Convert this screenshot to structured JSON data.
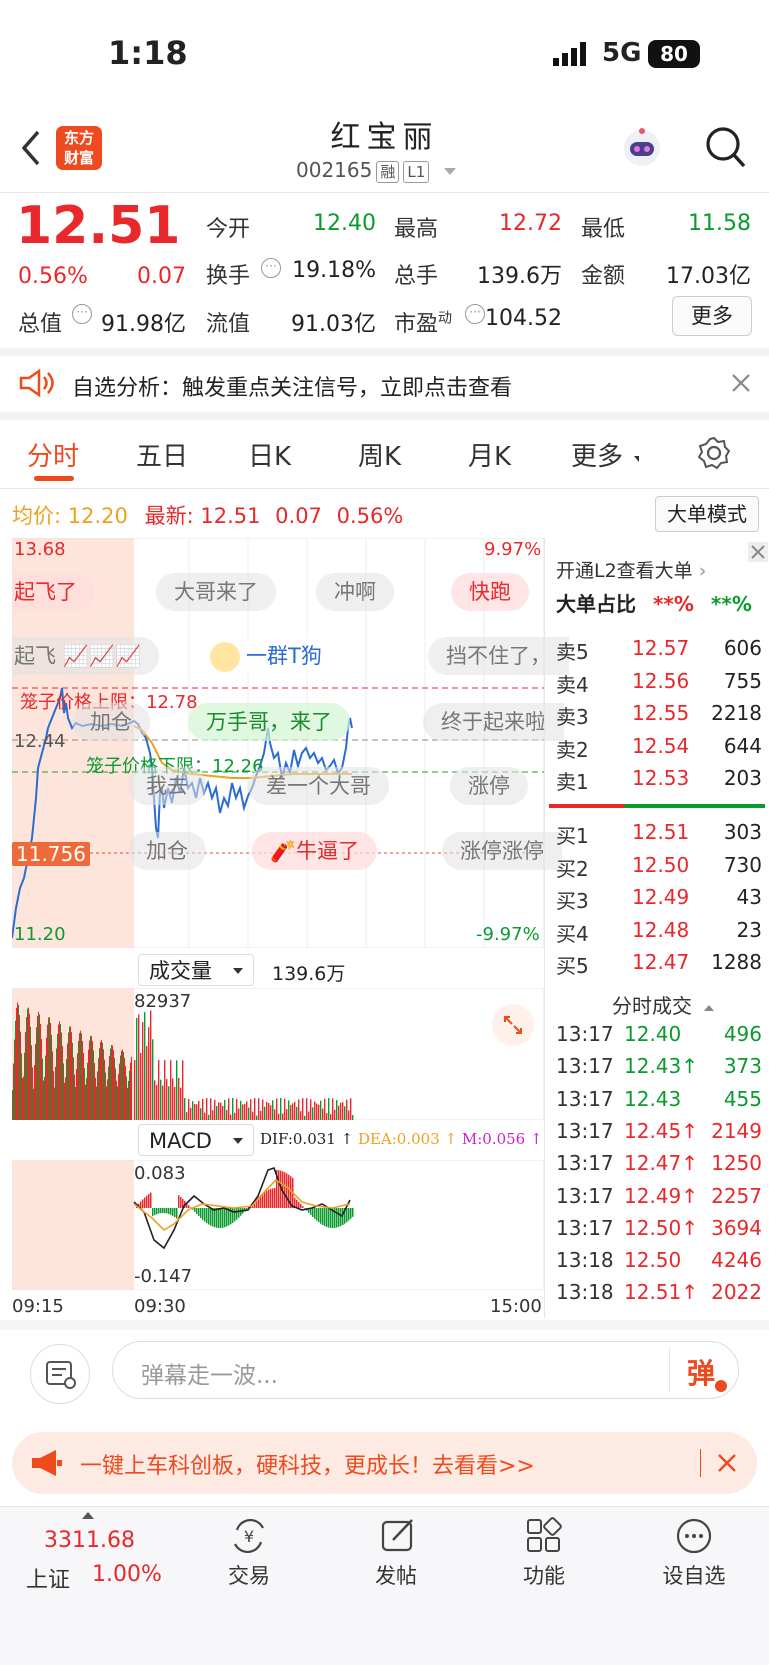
{
  "status": {
    "time": "1:18",
    "network": "5G",
    "battery": "80"
  },
  "header": {
    "logo_line1": "东方",
    "logo_line2": "财富",
    "title": "红宝丽",
    "code": "002165",
    "tag_margin": "融",
    "tag_level": "L1"
  },
  "quote": {
    "price": "12.51",
    "change_pct": "0.56%",
    "change": "0.07",
    "open_label": "今开",
    "open": "12.40",
    "high_label": "最高",
    "high": "12.72",
    "low_label": "最低",
    "low": "11.58",
    "turnover_label": "换手",
    "turnover": "19.18%",
    "volume_label": "总手",
    "volume": "139.6万",
    "amount_label": "金额",
    "amount": "17.03亿",
    "mktcap_label": "总值",
    "mktcap": "91.98亿",
    "float_label": "流值",
    "float": "91.03亿",
    "pe_label": "市盈",
    "pe_sup": "动",
    "pe": "104.52",
    "more_button": "更多"
  },
  "notice": {
    "text": "自选分析：触发重点关注信号，立即点击查看"
  },
  "tabs": [
    "分时",
    "五日",
    "日K",
    "周K",
    "月K",
    "更多"
  ],
  "chart_info": {
    "avg_label": "均价:",
    "avg": "12.20",
    "last_label": "最新:",
    "last": "12.51",
    "chg": "0.07",
    "pct": "0.56%",
    "mode_button": "大单模式"
  },
  "chart": {
    "y_top": "13.68",
    "y_bottom": "11.20",
    "pct_top": "9.97%",
    "pct_bottom": "-9.97%",
    "y_mid_left": "12.44",
    "y_ref": "11.756",
    "upper_limit_label": "笼子价格上限：12.78",
    "lower_limit_label": "笼子价格下限：12.26",
    "x_start": "09:15",
    "x_open": "09:30",
    "x_end": "15:00"
  },
  "bullets": [
    "起飞了",
    "大哥来了",
    "冲啊",
    "快跑",
    "起飞",
    "一群T狗",
    "挡不住了，",
    "加仓",
    "万手哥，来了",
    "终于起来啦",
    "我去",
    "差一个大哥",
    "涨停",
    "加仓",
    "牛逼了",
    "涨停涨停"
  ],
  "volume_panel": {
    "selector": "成交量",
    "total": "139.6万",
    "max": "82937"
  },
  "macd_panel": {
    "selector": "MACD",
    "dif": "DIF:0.031",
    "dea": "DEA:0.003",
    "m": "M:0.056",
    "top": "0.083",
    "bottom": "-0.147"
  },
  "orderbook": {
    "promo": "开通L2查看大单",
    "ratio_label": "大单占比",
    "ratio_a": "**%",
    "ratio_b": "**%",
    "asks": [
      {
        "label": "卖5",
        "price": "12.57",
        "vol": "606"
      },
      {
        "label": "卖4",
        "price": "12.56",
        "vol": "755"
      },
      {
        "label": "卖3",
        "price": "12.55",
        "vol": "2218"
      },
      {
        "label": "卖2",
        "price": "12.54",
        "vol": "644"
      },
      {
        "label": "卖1",
        "price": "12.53",
        "vol": "203"
      }
    ],
    "bids": [
      {
        "label": "买1",
        "price": "12.51",
        "vol": "303"
      },
      {
        "label": "买2",
        "price": "12.50",
        "vol": "730"
      },
      {
        "label": "买3",
        "price": "12.49",
        "vol": "43"
      },
      {
        "label": "买4",
        "price": "12.48",
        "vol": "23"
      },
      {
        "label": "买5",
        "price": "12.47",
        "vol": "1288"
      }
    ],
    "trades_title": "分时成交",
    "trades": [
      {
        "time": "13:17",
        "price": "12.40",
        "vol": "496",
        "color": "green"
      },
      {
        "time": "13:17",
        "price": "12.43↑",
        "vol": "373",
        "color": "green"
      },
      {
        "time": "13:17",
        "price": "12.43",
        "vol": "455",
        "color": "green"
      },
      {
        "time": "13:17",
        "price": "12.45↑",
        "vol": "2149",
        "color": "red"
      },
      {
        "time": "13:17",
        "price": "12.47↑",
        "vol": "1250",
        "color": "red"
      },
      {
        "time": "13:17",
        "price": "12.49↑",
        "vol": "2257",
        "color": "red"
      },
      {
        "time": "13:17",
        "price": "12.50↑",
        "vol": "3694",
        "color": "red"
      },
      {
        "time": "13:18",
        "price": "12.50",
        "vol": "4246",
        "color": "red"
      },
      {
        "time": "13:18",
        "price": "12.51↑",
        "vol": "2022",
        "color": "red"
      }
    ]
  },
  "danmu": {
    "placeholder": "弹幕走一波...",
    "send": "弹"
  },
  "ad": {
    "text": "一键上车科创板，硬科技，更成长！去看看>>"
  },
  "bottom_nav": {
    "index_value": "3311.68",
    "index_name": "上证",
    "index_pct": "1.00%",
    "items": [
      "交易",
      "发帖",
      "功能",
      "设自选"
    ]
  },
  "colors": {
    "up": "#e8282b",
    "down": "#0a9b2e",
    "brand": "#ee4a1e",
    "avg": "#f0a020"
  }
}
